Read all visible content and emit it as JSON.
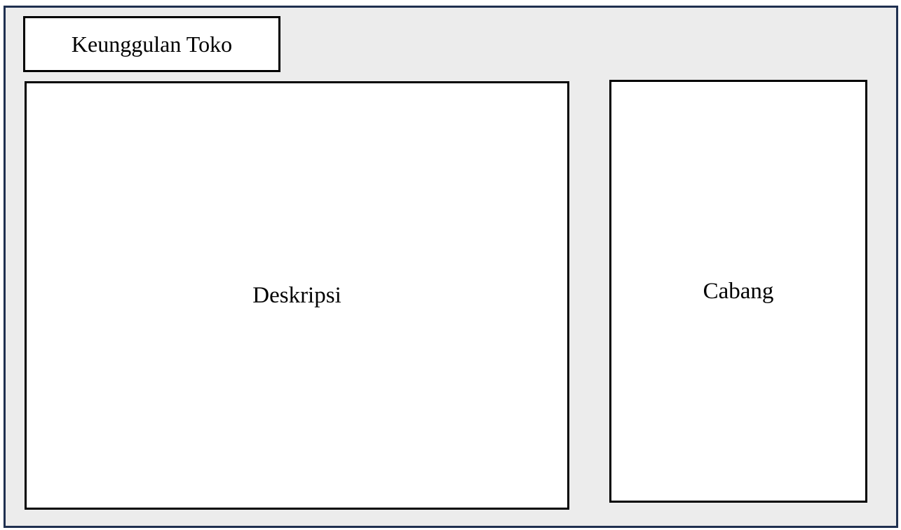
{
  "header": {
    "title": "Keunggulan Toko"
  },
  "main": {
    "description_label": "Deskripsi"
  },
  "aside": {
    "branch_label": "Cabang"
  },
  "colors": {
    "frame_border": "#1f3050",
    "frame_background": "#ececec",
    "box_background": "#ffffff",
    "box_border": "#000000"
  }
}
